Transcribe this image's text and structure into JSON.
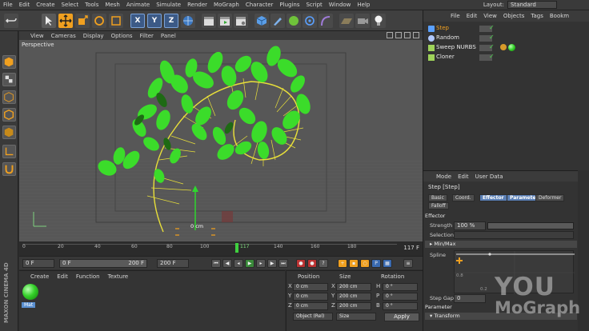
{
  "menu": [
    "File",
    "Edit",
    "Create",
    "Select",
    "Tools",
    "Mesh",
    "Animate",
    "Simulate",
    "Render",
    "MoGraph",
    "Character",
    "Plugins",
    "Script",
    "Window",
    "Help"
  ],
  "layout": {
    "label": "Layout:",
    "value": "Standard"
  },
  "toolbar": {
    "axis_x": "X",
    "axis_y": "Y",
    "axis_z": "Z"
  },
  "viewport": {
    "menu": [
      "View",
      "Cameras",
      "Display",
      "Options",
      "Filter",
      "Panel"
    ],
    "label": "Perspective",
    "origin_readout": "0 cm"
  },
  "timeline": {
    "ticks": [
      "0",
      "20",
      "40",
      "60",
      "80",
      "100",
      "117",
      "140",
      "160",
      "180"
    ],
    "current_marker": "117",
    "end_frame": "117 F"
  },
  "transport": {
    "start_field": "0 F",
    "range_start": "0 F",
    "range_end": "200 F",
    "end_field": "200 F"
  },
  "material_manager": {
    "menu": [
      "Create",
      "Edit",
      "Function",
      "Texture"
    ],
    "material_name": "Mat",
    "side_brand": "MAXON CINEMA 4D",
    "ball_color": "#35d12a"
  },
  "coordinates": {
    "headers": {
      "position": "Position",
      "size": "Size",
      "rotation": "Rotation"
    },
    "rows": [
      {
        "axis": "X",
        "pos": "0 cm",
        "size": "200 cm",
        "rot_axis": "H",
        "rot": "0 °"
      },
      {
        "axis": "Y",
        "pos": "0 cm",
        "size": "200 cm",
        "rot_axis": "P",
        "rot": "0 °"
      },
      {
        "axis": "Z",
        "pos": "0 cm",
        "size": "200 cm",
        "rot_axis": "B",
        "rot": "0 °"
      }
    ],
    "mode_dropdown": "Object (Rel)",
    "size_dropdown": "Size",
    "apply_label": "Apply"
  },
  "object_manager": {
    "menu": [
      "File",
      "Edit",
      "View",
      "Objects",
      "Tags",
      "Bookm"
    ],
    "objects": [
      {
        "name": "Step",
        "icon_color": "#5aa0ff",
        "selected": true
      },
      {
        "name": "Random",
        "icon_color": "#b0c8ff",
        "selected": false
      },
      {
        "name": "Sweep NURBS",
        "icon_color": "#9fd35a",
        "selected": false
      },
      {
        "name": "Cloner",
        "icon_color": "#9fd35a",
        "selected": false
      }
    ],
    "check_glyph": "✓"
  },
  "attributes": {
    "menu": [
      "Mode",
      "Edit",
      "User Data"
    ],
    "title": "Step [Step]",
    "tabs": [
      {
        "label": "Basic",
        "active": false
      },
      {
        "label": "Coord.",
        "active": false
      },
      {
        "label": "Effector",
        "active": true
      },
      {
        "label": "Parameter",
        "active": true
      },
      {
        "label": "Deformer",
        "active": false
      },
      {
        "label": "Falloff",
        "active": false
      }
    ],
    "section_effector": "Effector",
    "strength_label": "Strength",
    "strength_value": "100 %",
    "strength_fraction": 1.0,
    "selection_label": "Selection",
    "minmax_label": "▸ Min/Max",
    "spline_label": "Spline",
    "spline_axis_y": "0.8",
    "spline_axis_x": "0.2",
    "step_gap_label": "Step Gap",
    "step_gap_value": "0",
    "section_parameter": "Parameter",
    "transform_label": "▾ Transform"
  },
  "watermark": {
    "line1": "YOU",
    "line2": "MoGraph"
  }
}
